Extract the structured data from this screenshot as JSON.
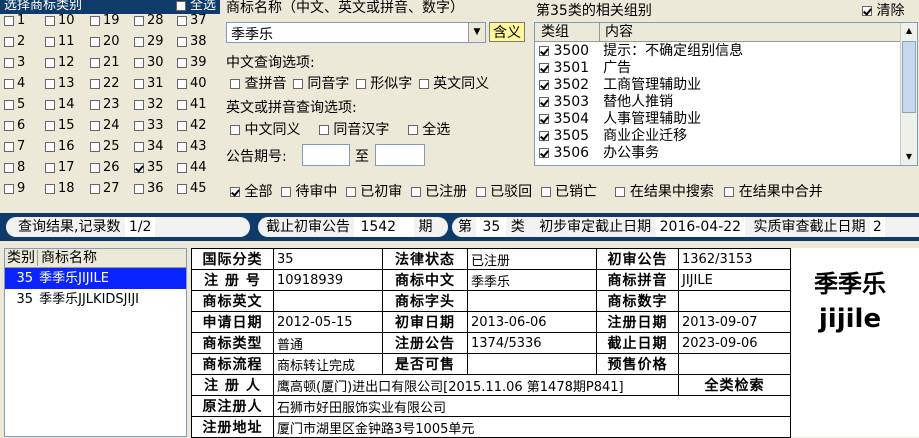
{
  "class_panel": {
    "header": "选择商标类别",
    "select_all": "全选",
    "classes": [
      "1",
      "2",
      "3",
      "4",
      "5",
      "6",
      "7",
      "8",
      "9",
      "10",
      "11",
      "12",
      "13",
      "14",
      "15",
      "16",
      "17",
      "18",
      "19",
      "20",
      "21",
      "22",
      "23",
      "24",
      "25",
      "26",
      "27",
      "28",
      "29",
      "30",
      "31",
      "32",
      "33",
      "34",
      "35",
      "36",
      "37",
      "38",
      "39",
      "40",
      "41",
      "42",
      "43",
      "44",
      "45"
    ],
    "checked": [
      "35"
    ]
  },
  "name_search": {
    "label": "商标名称（中文、英文或拼音、数字）",
    "value": "季季乐",
    "contain_button": "含义"
  },
  "cn_options": {
    "label": "中文查询选项:",
    "items": [
      "查拼音",
      "同音字",
      "形似字",
      "英文同义"
    ]
  },
  "en_options": {
    "label": "英文或拼音查询选项:",
    "items": [
      "中文同义",
      "同音汉字",
      "全选"
    ]
  },
  "announcement": {
    "label": "公告期号:",
    "to": "至"
  },
  "groups": {
    "title": "第35类的相关组别",
    "clear": "清除",
    "col_group": "类组",
    "col_content": "内容",
    "rows": [
      {
        "code": "3500",
        "text": "提示：不确定组别信息"
      },
      {
        "code": "3501",
        "text": "广告"
      },
      {
        "code": "3502",
        "text": "工商管理辅助业"
      },
      {
        "code": "3503",
        "text": "替他人推销"
      },
      {
        "code": "3504",
        "text": "人事管理辅助业"
      },
      {
        "code": "3505",
        "text": "商业企业迁移"
      },
      {
        "code": "3506",
        "text": "办公事务"
      }
    ]
  },
  "filters": {
    "items": [
      "全部",
      "待审中",
      "已初审",
      "已注册",
      "已驳回",
      "已销亡"
    ],
    "search_in_results": "在结果中搜索",
    "merge_in_results": "在结果中合并"
  },
  "status": {
    "result_label": "查询结果,记录数",
    "result_value": "1/2",
    "cutoff_label": "截止初审公告",
    "cutoff_value": "1542",
    "cutoff_unit": "期",
    "class_prefix": "第",
    "class_value": "35",
    "class_suffix": "类",
    "prelim_label": "初步审定截止日期",
    "prelim_value": "2016-04-22",
    "substantive_label": "实质审查截止日期",
    "substantive_value": "2"
  },
  "results": {
    "col_class": "类别",
    "col_name": "商标名称",
    "rows": [
      {
        "cls": "35",
        "name": "季季乐JIJILE"
      },
      {
        "cls": "35",
        "name": "季季乐JJLKIDSJIJI"
      }
    ]
  },
  "detail": {
    "intl_class_k": "国际分类",
    "intl_class_v": "35",
    "legal_k": "法律状态",
    "legal_v": "已注册",
    "prelim_pub_k": "初审公告",
    "prelim_pub_v": "1362/3153",
    "reg_no_k": "注 册 号",
    "reg_no_v": "10918939",
    "cn_name_k": "商标中文",
    "cn_name_v": "季季乐",
    "pinyin_k": "商标拼音",
    "pinyin_v": "JIJILE",
    "en_k": "商标英文",
    "en_v": "",
    "initial_k": "商标字头",
    "initial_v": "",
    "digit_k": "商标数字",
    "digit_v": "",
    "apply_date_k": "申请日期",
    "apply_date_v": "2012-05-15",
    "prelim_date_k": "初审日期",
    "prelim_date_v": "2013-06-06",
    "reg_date_k": "注册日期",
    "reg_date_v": "2013-09-07",
    "type_k": "商标类型",
    "type_v": "普通",
    "reg_pub_k": "注册公告",
    "reg_pub_v": "1374/5336",
    "expire_k": "截止日期",
    "expire_v": "2023-09-06",
    "flow_k": "商标流程",
    "flow_v": "商标转让完成",
    "sale_k": "是否可售",
    "sale_v": "",
    "price_k": "预售价格",
    "price_v": "",
    "registrant_k": "注 册 人",
    "registrant_v": "鹰高顿(厦门)进出口有限公司[2015.11.06 第1478期P841]",
    "full_search": "全类检索",
    "orig_k": "原注册人",
    "orig_v": "石狮市好田服饰实业有限公司",
    "addr_k": "注册地址",
    "addr_v": "厦门市湖里区金钟路3号1005单元"
  },
  "preview": {
    "cn": "季季乐",
    "en": "jijile"
  }
}
